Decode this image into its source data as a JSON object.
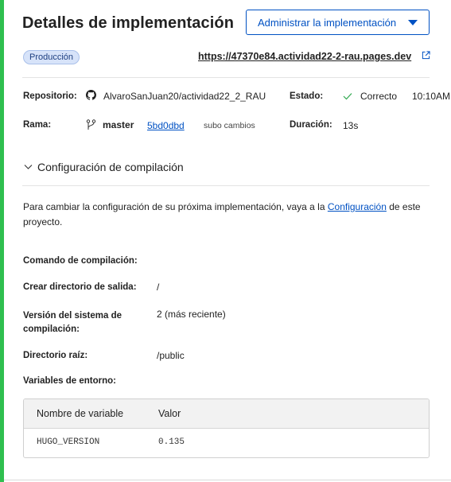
{
  "header": {
    "title": "Detalles de implementación",
    "manage_button": "Administrar la implementación"
  },
  "environment": {
    "badge": "Producción",
    "url": "https://47370e84.actividad22-2-rau.pages.dev"
  },
  "details": {
    "repo_label": "Repositorio:",
    "repo_value": "AlvaroSanJuan20/actividad22_2_RAU",
    "status_label": "Estado:",
    "status_value": "Correcto",
    "status_time": "10:10AM",
    "branch_label": "Rama:",
    "branch_value": "master",
    "commit_hash": "5bd0dbd",
    "commit_message": "subo cambios",
    "duration_label": "Duración:",
    "duration_value": "13s"
  },
  "build_config": {
    "section_title": "Configuración de compilación",
    "para_before": "Para cambiar la configuración de su próxima implementación, vaya a la ",
    "para_link": "Configuración",
    "para_after": " de este proyecto.",
    "rows": {
      "build_command_label": "Comando de compilación:",
      "build_command_value": "",
      "output_dir_label": "Crear directorio de salida:",
      "output_dir_value": "/",
      "system_version_label": "Versión del sistema de compilación:",
      "system_version_value": "2 (más reciente)",
      "root_dir_label": "Directorio raíz:",
      "root_dir_value": "/public",
      "env_vars_label": "Variables de entorno:"
    },
    "env_table": {
      "col_name": "Nombre de variable",
      "col_value": "Valor",
      "rows": [
        {
          "name": "HUGO_VERSION",
          "value": "0.135"
        }
      ]
    }
  },
  "colors": {
    "accent_green": "#2fbf4f",
    "link_blue": "#0051c3",
    "badge_bg": "#d7e3f9"
  }
}
